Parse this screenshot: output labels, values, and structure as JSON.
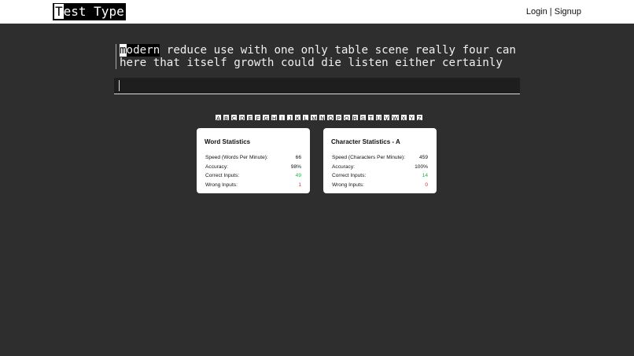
{
  "header": {
    "logo_first": "T",
    "logo_rest": "est Type",
    "login": "Login",
    "separator": " | ",
    "signup": "Signup"
  },
  "typing": {
    "current_word_first": "m",
    "current_word_rest": "odern",
    "line1_rest": " reduce use with one only table scene really four can",
    "line2": "here that itself growth could die listen either certainly"
  },
  "input": {
    "value": ""
  },
  "letters": [
    "A",
    "B",
    "C",
    "D",
    "E",
    "F",
    "G",
    "H",
    "I",
    "J",
    "K",
    "L",
    "M",
    "N",
    "O",
    "P",
    "Q",
    "R",
    "S",
    "T",
    "U",
    "V",
    "W",
    "X",
    "Y",
    "Z"
  ],
  "word_stats": {
    "title": "Word Statistics",
    "speed_label": "Speed (Words Per Minute):",
    "speed_value": "66",
    "accuracy_label": "Accuracy:",
    "accuracy_value": "98%",
    "correct_label": "Correct Inputs:",
    "correct_value": "49",
    "wrong_label": "Wrong Inputs:",
    "wrong_value": "1"
  },
  "char_stats": {
    "title": "Character Statistics - A",
    "speed_label": "Speed (Characters Per Minute):",
    "speed_value": "459",
    "accuracy_label": "Accuracy:",
    "accuracy_value": "100%",
    "correct_label": "Correct Inputs:",
    "correct_value": "14",
    "wrong_label": "Wrong Inputs:",
    "wrong_value": "0"
  },
  "colors": {
    "background": "#2e2e2e",
    "correct": "#2eaa4a",
    "wrong": "#e03030"
  }
}
